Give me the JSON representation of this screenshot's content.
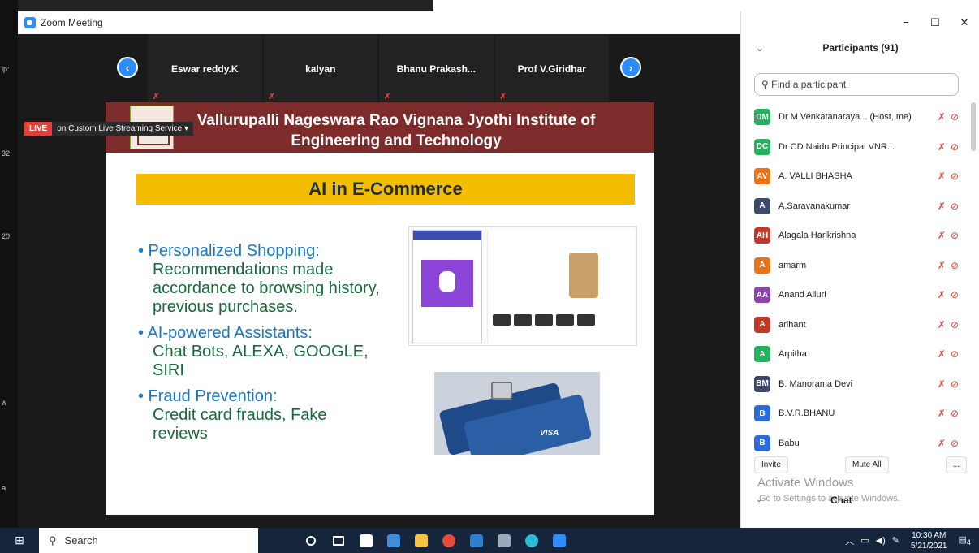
{
  "window": {
    "title": "Zoom Meeting",
    "controls": [
      "−",
      "☐",
      "✕"
    ]
  },
  "desktop_edge": [
    "ip:",
    "32",
    "20",
    "A",
    "a"
  ],
  "live": {
    "badge": "LIVE",
    "text": "on Custom Live Streaming Service ▾"
  },
  "thumbnails": [
    {
      "name": "Eswar reddy.K"
    },
    {
      "name": "kalyan"
    },
    {
      "name": "Bhanu Prakash..."
    },
    {
      "name": "Prof V.Giridhar"
    }
  ],
  "slide": {
    "header_line1": "Vallurupalli Nageswara Rao Vignana Jyothi Institute of",
    "header_line2": "Engineering and Technology",
    "title": "AI in E-Commerce",
    "bullets": [
      {
        "head": "• Personalized Shopping:",
        "body": "Recommendations made accordance to browsing history, previous purchases."
      },
      {
        "head": "• AI-powered Assistants:",
        "body": "Chat Bots, ALEXA, GOOGLE, SIRI"
      },
      {
        "head": "• Fraud Prevention:",
        "body": "Credit card frauds, Fake reviews"
      }
    ],
    "card_text": "VISA"
  },
  "participants": {
    "header": "Participants (91)",
    "search_placeholder": "Find a participant",
    "list": [
      {
        "initials": "DM",
        "color": "#23b35e",
        "name": "Dr M Venkatanaraya... (Host, me)"
      },
      {
        "initials": "DC",
        "color": "#23b35e",
        "name": "Dr CD Naidu Principal VNR..."
      },
      {
        "initials": "AV",
        "color": "#e8731a",
        "name": "A. VALLI BHASHA"
      },
      {
        "initials": "A",
        "color": "#3d4a6b",
        "name": "A.Saravanakumar"
      },
      {
        "initials": "AH",
        "color": "#c0392b",
        "name": "Alagala Harikrishna"
      },
      {
        "initials": "A",
        "color": "#e8731a",
        "name": "amarm"
      },
      {
        "initials": "AA",
        "color": "#8e44ad",
        "name": "Anand Alluri"
      },
      {
        "initials": "A",
        "color": "#c0392b",
        "name": "arihant"
      },
      {
        "initials": "A",
        "color": "#23b35e",
        "name": "Arpitha"
      },
      {
        "initials": "BM",
        "color": "#3d4a6b",
        "name": "B. Manorama Devi"
      },
      {
        "initials": "B",
        "color": "#2d6bd6",
        "name": "B.V.R.BHANU"
      },
      {
        "initials": "B",
        "color": "#2d6bd6",
        "name": "Babu"
      }
    ],
    "footer": {
      "invite": "Invite",
      "mute_all": "Mute All",
      "more": "..."
    },
    "activate_1": "Activate Windows",
    "activate_2": "Go to Settings to activate Windows.",
    "chat": "Chat"
  },
  "taskbar": {
    "search": "Search",
    "time": "10:30 AM",
    "date": "5/21/2021",
    "notifications": "4"
  }
}
